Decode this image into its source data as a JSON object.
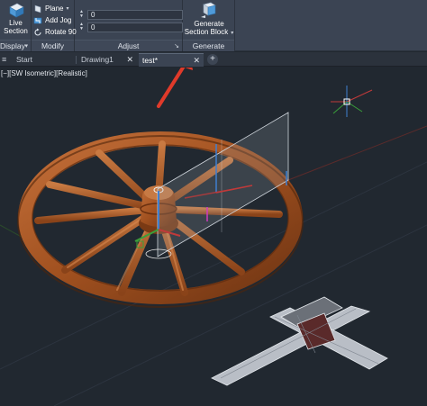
{
  "ribbon": {
    "display_panel": {
      "live_section": {
        "line1": "Live",
        "line2": "Section"
      },
      "title": "Display"
    },
    "modify_panel": {
      "plane": "Plane",
      "add_jog": "Add Jog",
      "rotate_90": "Rotate 90",
      "title": "Modify"
    },
    "adjust_panel": {
      "field1_value": "0",
      "field2_value": "0",
      "title": "Adjust"
    },
    "generate_panel": {
      "generate_section_block": {
        "line1": "Generate",
        "line2": "Section Block"
      },
      "title": "Generate"
    }
  },
  "tabs": [
    {
      "label": "Start"
    },
    {
      "label": "Drawing1"
    },
    {
      "label": "test*"
    }
  ],
  "viewport": {
    "view_label": "[−][SW Isometric][Realistic]"
  },
  "colors": {
    "ribbon_bg": "#3b4453",
    "viewport_bg": "#212830",
    "wheel_wood": "#a0501f",
    "annotation_arrow": "#e03a2a",
    "section_plane": "#9aa3ad"
  },
  "icons": {
    "live_section": "live-section-icon",
    "plane": "plane-icon",
    "add_jog": "add-jog-icon",
    "rotate_90": "rotate-90-icon",
    "generate_section_block": "generate-section-block-icon",
    "view_cube": "ucs-crosshair-icon"
  }
}
